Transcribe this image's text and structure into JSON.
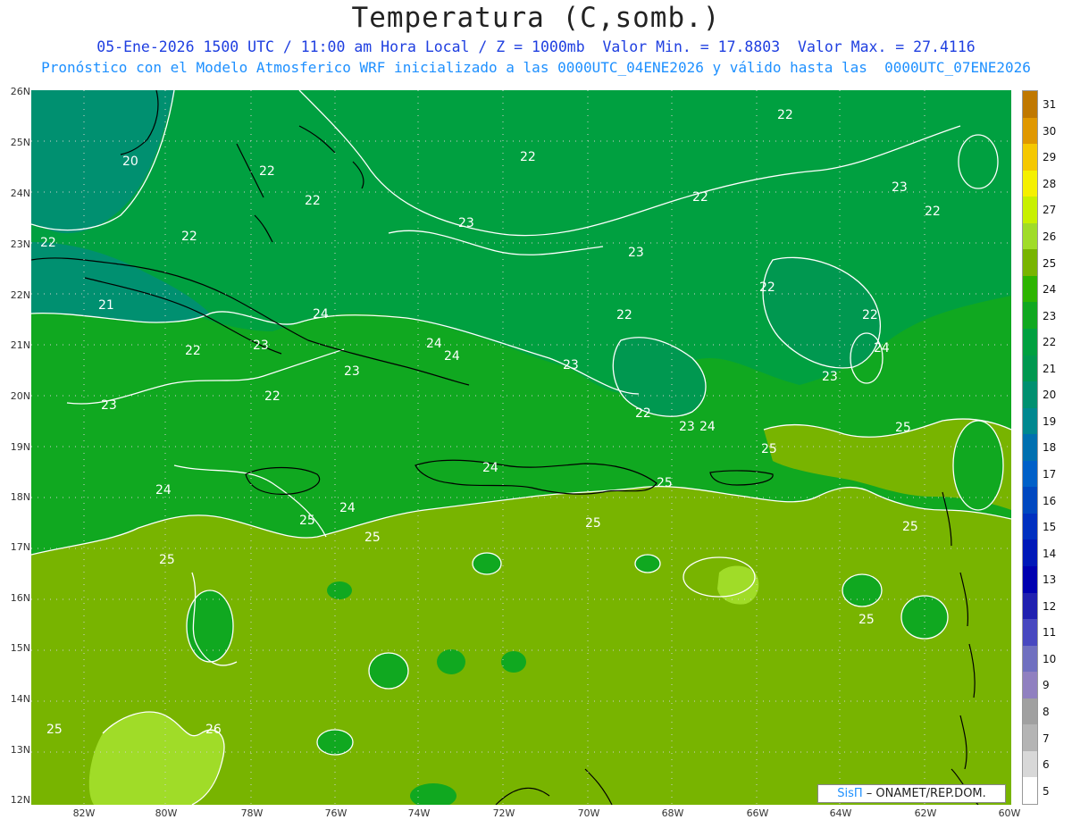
{
  "header": {
    "title": "Temperatura (C,somb.)",
    "subtitle_line1": "05-Ene-2026 1500 UTC / 11:00 am Hora Local / Z = 1000mb  Valor Min. = 17.8803  Valor Max. = 27.4116",
    "subtitle_line2": "Pronóstico con el Modelo Atmosferico WRF inicializado a las 0000UTC_04ENE2026 y válido hasta las  0000UTC_07ENE2026"
  },
  "axes": {
    "lat_labels": [
      "26N",
      "25N",
      "24N",
      "23N",
      "22N",
      "21N",
      "20N",
      "19N",
      "18N",
      "17N",
      "16N",
      "15N",
      "14N",
      "13N",
      "12N"
    ],
    "lon_labels": [
      "82W",
      "80W",
      "78W",
      "76W",
      "74W",
      "72W",
      "70W",
      "68W",
      "66W",
      "64W",
      "62W",
      "60W"
    ]
  },
  "colorbar": {
    "labels": [
      "31",
      "30",
      "29",
      "28",
      "27",
      "26",
      "25",
      "24",
      "23",
      "22",
      "21",
      "20",
      "19",
      "18",
      "17",
      "16",
      "15",
      "14",
      "13",
      "12",
      "11",
      "10",
      "9",
      "8",
      "7",
      "6",
      "5"
    ],
    "colors": [
      "#c07800",
      "#e09800",
      "#f5c800",
      "#f5f000",
      "#c8f000",
      "#a0dc28",
      "#78b400",
      "#2db400",
      "#10a820",
      "#00a040",
      "#009850",
      "#009070",
      "#008890",
      "#0070b0",
      "#0060c8",
      "#0048c0",
      "#0030c0",
      "#0018b8",
      "#0000b0",
      "#2020b0",
      "#4848c0",
      "#7070c0",
      "#9080c0",
      "#a0a0a0",
      "#b4b4b4",
      "#d8d8d8",
      "#ffffff"
    ]
  },
  "contour_labels": [
    "22",
    "20",
    "22",
    "22",
    "22",
    "22",
    "22",
    "21",
    "22",
    "23",
    "22",
    "23",
    "22",
    "23",
    "22",
    "24",
    "23",
    "24",
    "24",
    "22",
    "23",
    "22",
    "23",
    "22",
    "22",
    "23",
    "24",
    "23",
    "24",
    "25",
    "25",
    "23",
    "24",
    "25",
    "25",
    "25",
    "25",
    "24",
    "25",
    "24",
    "25",
    "26",
    "25",
    "25"
  ],
  "credit": {
    "system": "SisΠ",
    "org": " – ONAMET/REP.DOM."
  }
}
